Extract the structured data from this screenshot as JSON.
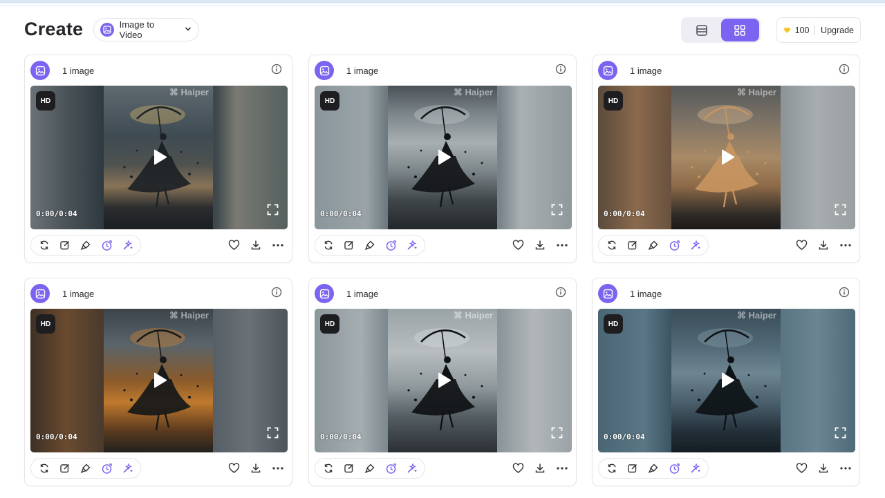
{
  "header": {
    "title": "Create",
    "mode_label": "Image to Video",
    "credits": "100",
    "upgrade_label": "Upgrade"
  },
  "colors": {
    "accent": "#7c63f2",
    "gem": "#f5b800"
  },
  "cards": [
    {
      "count_label": "1 image",
      "hd_label": "HD",
      "time": "0:00/0:04",
      "watermark": "⌘ Haiper",
      "scene": "golden-umbrella-dancer"
    },
    {
      "count_label": "1 image",
      "hd_label": "HD",
      "time": "0:00/0:04",
      "watermark": "⌘ Haiper",
      "scene": "grey-sky-dancer"
    },
    {
      "count_label": "1 image",
      "hd_label": "HD",
      "time": "0:00/0:04",
      "watermark": "⌘ Haiper",
      "scene": "amber-dress-dancer"
    },
    {
      "count_label": "1 image",
      "hd_label": "HD",
      "time": "0:00/0:04",
      "watermark": "⌘ Haiper",
      "scene": "orange-splash-umbrella"
    },
    {
      "count_label": "1 image",
      "hd_label": "HD",
      "time": "0:00/0:04",
      "watermark": "⌘ Haiper",
      "scene": "monochrome-dancer"
    },
    {
      "count_label": "1 image",
      "hd_label": "HD",
      "time": "0:00/0:04",
      "watermark": "⌘ Haiper",
      "scene": "blue-dusk-dancer"
    }
  ],
  "icons": {
    "mode": "image-icon",
    "views": [
      "list-view-icon",
      "grid-view-icon"
    ],
    "gem": "gem-icon",
    "card_tools": [
      "regenerate-icon",
      "edit-icon",
      "brush-icon",
      "extend-icon",
      "magic-icon"
    ],
    "card_actions": [
      "heart-icon",
      "download-icon",
      "more-icon"
    ]
  }
}
